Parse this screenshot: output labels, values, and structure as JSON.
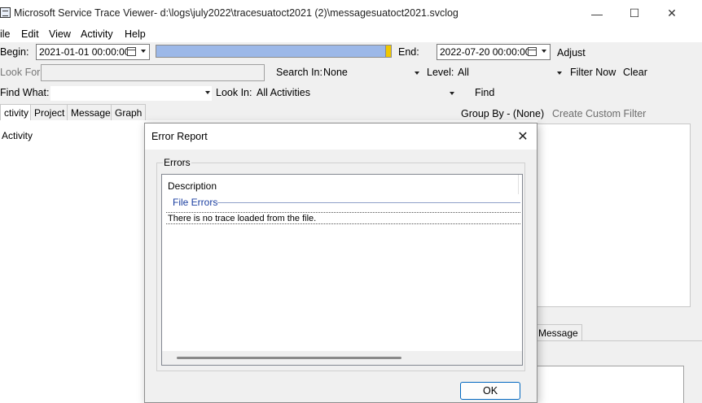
{
  "window": {
    "title": "Microsoft Service Trace Viewer- d:\\logs\\july2022\\tracesuatoct2021 (2)\\messagesuatoct2021.svclog",
    "minimize_glyph": "—",
    "maximize_glyph": "☐",
    "close_glyph": "✕"
  },
  "menu": {
    "items": [
      "ile",
      "Edit",
      "View",
      "Activity",
      "Help"
    ]
  },
  "toolbar": {
    "begin_label": "Begin:",
    "begin_value": "2021-01-01  00:00:00",
    "end_label": "End:",
    "end_value": "2022-07-20  00:00:00",
    "adjust_label": "Adjust",
    "look_for_label": "Look For",
    "search_in_label": "Search In:",
    "search_in_value": "None",
    "level_label": "Level:",
    "level_value": "All",
    "filter_now_label": "Filter Now",
    "clear_label": "Clear",
    "find_what_label": "Find What:",
    "look_in_label": "Look In:",
    "look_in_value": "All Activities",
    "find_label": "Find"
  },
  "tabs": [
    "ctivity",
    "Project",
    "Message",
    "Graph"
  ],
  "group_by_label": "Group By - (None)",
  "create_custom_filter_label": "Create Custom Filter",
  "left_panel": {
    "column_header": "Activity"
  },
  "right_panel": {
    "tab_message": "Message"
  },
  "dialog": {
    "title": "Error Report",
    "close_glyph": "✕",
    "group_label": "Errors",
    "list_header": "Description",
    "group_name": "File Errors",
    "rows": [
      "There is no trace loaded from the file."
    ],
    "ok_label": "OK"
  },
  "colors": {
    "range_bar": "#9cb8e8",
    "range_thumb": "#f0c800",
    "group_text": "#1a3ea0",
    "ok_border": "#0067c0"
  }
}
